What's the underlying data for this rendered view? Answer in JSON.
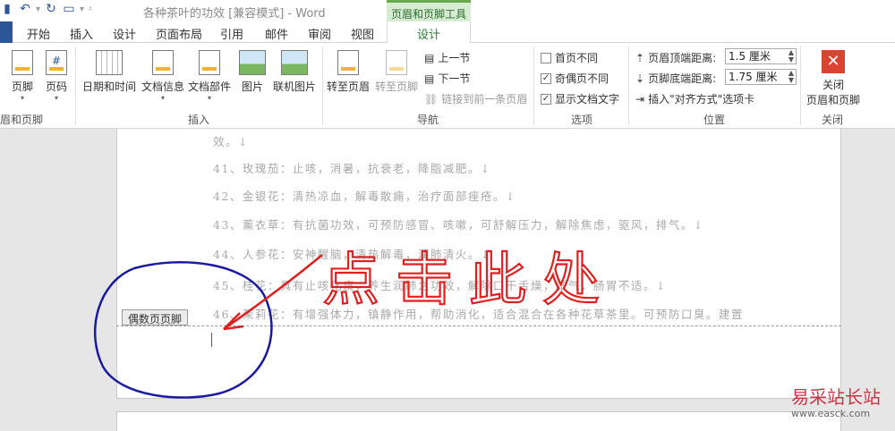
{
  "window": {
    "title": "各种茶叶的功效 [兼容模式] - Word"
  },
  "context_group": {
    "label": "页眉和页脚工具"
  },
  "tabs": [
    "开始",
    "插入",
    "设计",
    "页面布局",
    "引用",
    "邮件",
    "审阅",
    "视图"
  ],
  "context_tab": "设计",
  "ribbon": {
    "header_footer": {
      "footer": "页脚",
      "page_number": "页码",
      "group_label": "眉和页脚"
    },
    "insert": {
      "date_time": "日期和时间",
      "doc_info": "文档信息",
      "doc_parts": "文档部件",
      "picture": "图片",
      "online_picture": "联机图片",
      "group_label": "插入"
    },
    "navigation": {
      "goto_header": "转至页眉",
      "goto_footer": "转至页脚",
      "prev_section": "上一节",
      "next_section": "下一节",
      "link_prev": "链接到前一条页眉",
      "group_label": "导航"
    },
    "options": {
      "diff_first": "首页不同",
      "diff_odd_even": "奇偶页不同",
      "show_doc_text": "显示文档文字",
      "group_label": "选项"
    },
    "position": {
      "header_top_label": "页眉顶端距离:",
      "header_top_value": "1.5 厘米",
      "footer_bottom_label": "页脚底端距离:",
      "footer_bottom_value": "1.75 厘米",
      "insert_align_tab": "插入\"对齐方式\"选项卡",
      "group_label": "位置"
    },
    "close": {
      "line1": "关闭",
      "line2": "页眉和页脚",
      "group_label": "关闭"
    }
  },
  "document": {
    "lines": [
      "效。↓",
      "41、玫瑰茄：止咳，消暑，抗衰老，降脂减肥。↓",
      "42、金银花：清热凉血，解毒散痈，治疗面部痤疮。↓",
      "43、薰衣草：有抗菌功效，可预防感冒、咳嗽，可舒解压力，解除焦虑，驱风，排气。↓",
      "44、人参花：安神醒脑，清热解毒，润肺清火。↓",
      "45、桂花：具有止咳化痰，养生润肺之功效，解除口干舌燥，胀气，肠胃不适。↓",
      "46、茉莉花：有增强体力，镇静作用，帮助消化，适合混合在各种花草茶里。可预防口臭。建置"
    ],
    "footer_tag": "偶数页页脚",
    "annotation_text": "点击此处"
  },
  "watermark": {
    "name": "易采站长站",
    "url": "www.easck.com"
  },
  "colors": {
    "accent": "#2b579a",
    "context": "#6aa84f",
    "annotation_red": "#e02020",
    "annotation_blue": "#1a1aa0"
  }
}
